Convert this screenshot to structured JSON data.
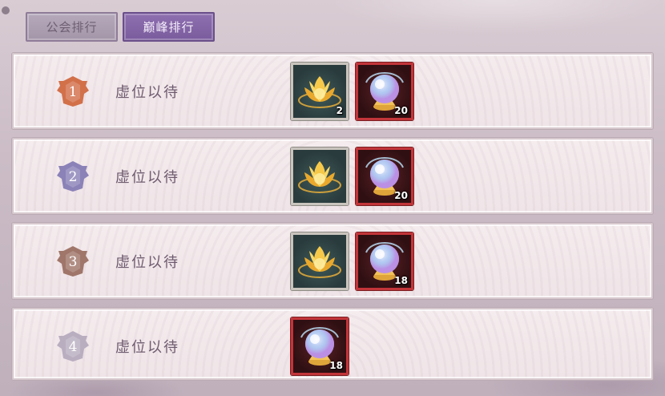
{
  "tabs": [
    {
      "label": "公会排行",
      "active": false
    },
    {
      "label": "巅峰排行",
      "active": true
    }
  ],
  "rows": [
    {
      "rank": "1",
      "name": "虚位以待",
      "badge_color": "#d2704a",
      "rewards": [
        {
          "type": "lotus-gem",
          "count": "2"
        },
        {
          "type": "crystal-orb",
          "count": "20"
        }
      ]
    },
    {
      "rank": "2",
      "name": "虚位以待",
      "badge_color": "#8b82b8",
      "rewards": [
        {
          "type": "lotus-gem",
          "count": ""
        },
        {
          "type": "crystal-orb",
          "count": "20"
        }
      ]
    },
    {
      "rank": "3",
      "name": "虚位以待",
      "badge_color": "#a0766a",
      "rewards": [
        {
          "type": "lotus-gem",
          "count": ""
        },
        {
          "type": "crystal-orb",
          "count": "18"
        }
      ]
    },
    {
      "rank": "4",
      "name": "虚位以待",
      "badge_color": "#b9aec0",
      "rewards": [
        {
          "type": "crystal-orb",
          "count": "18"
        }
      ]
    }
  ]
}
